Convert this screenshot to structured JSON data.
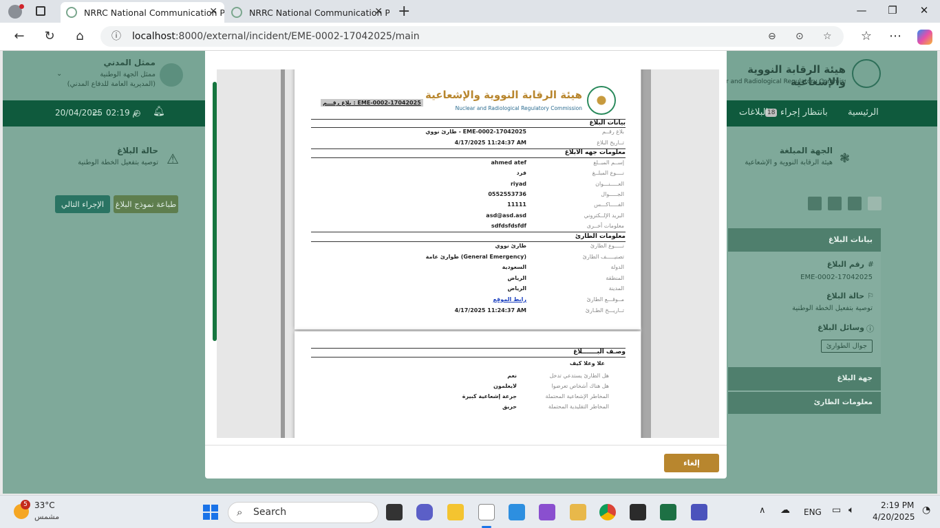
{
  "browser": {
    "tabs": [
      {
        "title": "NRRC National Communication P"
      },
      {
        "title": "NRRC National Communication P"
      }
    ],
    "url_host": "localhost",
    "url_rest": ":8000/external/incident/EME-0002-17042025/main"
  },
  "app": {
    "user_name": "ممثل المدني",
    "user_role": "ممثل الجهة الوطنية",
    "user_org": "(المديرية العامة للدفاع المدني)",
    "org_name_ar": "هيئة الرقابة النووية والإشعاعية",
    "org_name_en": "Nuclear and Radiological Regulatory Commission",
    "date": "20/04/2025",
    "time": "02:19 م",
    "nav": {
      "home": "الرئيسية",
      "pending": "بانتظار إجراء",
      "pending_count": "18",
      "reports": "البلاغات"
    },
    "status_title": "حالة البلاغ",
    "status_sub": "توصية بتفعيل الخطة الوطنية",
    "reporter_title": "الجهة المبلغة",
    "reporter_sub": "هيئة الرقابة النووية و الإشعاعية",
    "print_btn": "طباعة نموذج البلاغ",
    "next_btn": "الإجراء التالي",
    "side": {
      "header": "بيانات البلاغ",
      "num_label": "رقم البلاغ",
      "num_value": "EME-0002-17042025",
      "status_label": "حالة البلاغ",
      "status_value": "توصية بتفعيل الخطة الوطنية",
      "means_label": "وسائل البلاغ",
      "means_value": "جوال الطوارئ",
      "entity": "جهة البلاغ",
      "emergency_info": "معلومات الطارئ"
    }
  },
  "report": {
    "num_badge": "بلاغ رقـــم : EME-0002-17042025",
    "org_ar": "هيئة الرقابة النووية والإشعاعية",
    "org_en": "Nuclear and Radiological Regulatory Commission",
    "sec1": "بيانات البلاغ",
    "sec1_rows": [
      {
        "label": "بلاغ رقــم",
        "value": "طارئ نووي - EME-0002-17042025"
      },
      {
        "label": "تــاريخ البلاغ",
        "value": "4/17/2025 11:24:37 AM"
      }
    ],
    "sec2": "معلومات جهه الابلاغ",
    "sec2_rows": [
      {
        "label": "إســم المبــلغ",
        "value": "ahmed atef"
      },
      {
        "label": "نــــوع المبلــغ",
        "value": "فرد"
      },
      {
        "label": "العـــــنـــوان",
        "value": "riyad"
      },
      {
        "label": "الجـــــوال",
        "value": "0552553736"
      },
      {
        "label": "الفـــــاكـــس",
        "value": "11111"
      },
      {
        "label": "البريد الإلــكتروني",
        "value": "asd@asd.asd"
      },
      {
        "label": "معلومات أخــرى",
        "value": "sdfdsfdsfdf"
      }
    ],
    "sec3": "معلومات الطارئ",
    "sec3_rows": [
      {
        "label": "نـــــوع الطارئ",
        "value": "طارئ نووي"
      },
      {
        "label": "تصنيـــــف الطارئ",
        "value": "طوارئ عامة (General Emergency)"
      },
      {
        "label": "الدولة",
        "value": "السعودية"
      },
      {
        "label": "المنطقة",
        "value": "الرياض"
      },
      {
        "label": "المدينة",
        "value": "الرياض"
      },
      {
        "label": "مــوقـــع الطارئ",
        "value": "رابط الموقع"
      },
      {
        "label": "تــاريـــخ الطـارئ",
        "value": "4/17/2025 11:24:37 AM"
      }
    ],
    "sec4": "وصـف البـــــــلاغ",
    "desc": "علا وعلا كيف",
    "sec4_rows": [
      {
        "label": "هل الطارئ يستدعي تدخل",
        "value": "نعم"
      },
      {
        "label": "هل هناك أشخاص تعرضوا",
        "value": "لايعلمون"
      },
      {
        "label": "المخاطر الإشعاعية المحتملة",
        "value": "جرعة إشعاعية كبيرة"
      },
      {
        "label": "المخاطر التقليدية المحتملة",
        "value": "حريق"
      }
    ]
  },
  "modal": {
    "cancel": "إلغاء"
  },
  "taskbar": {
    "weather_temp": "33°C",
    "weather_desc": "مشمس",
    "weather_badge": "5",
    "search": "Search",
    "lang": "ENG",
    "time": "2:19 PM",
    "date": "4/20/2025"
  },
  "colors": {
    "primary": "#0f5a3d",
    "accent": "#b8862e",
    "scroll": "#16763f"
  }
}
